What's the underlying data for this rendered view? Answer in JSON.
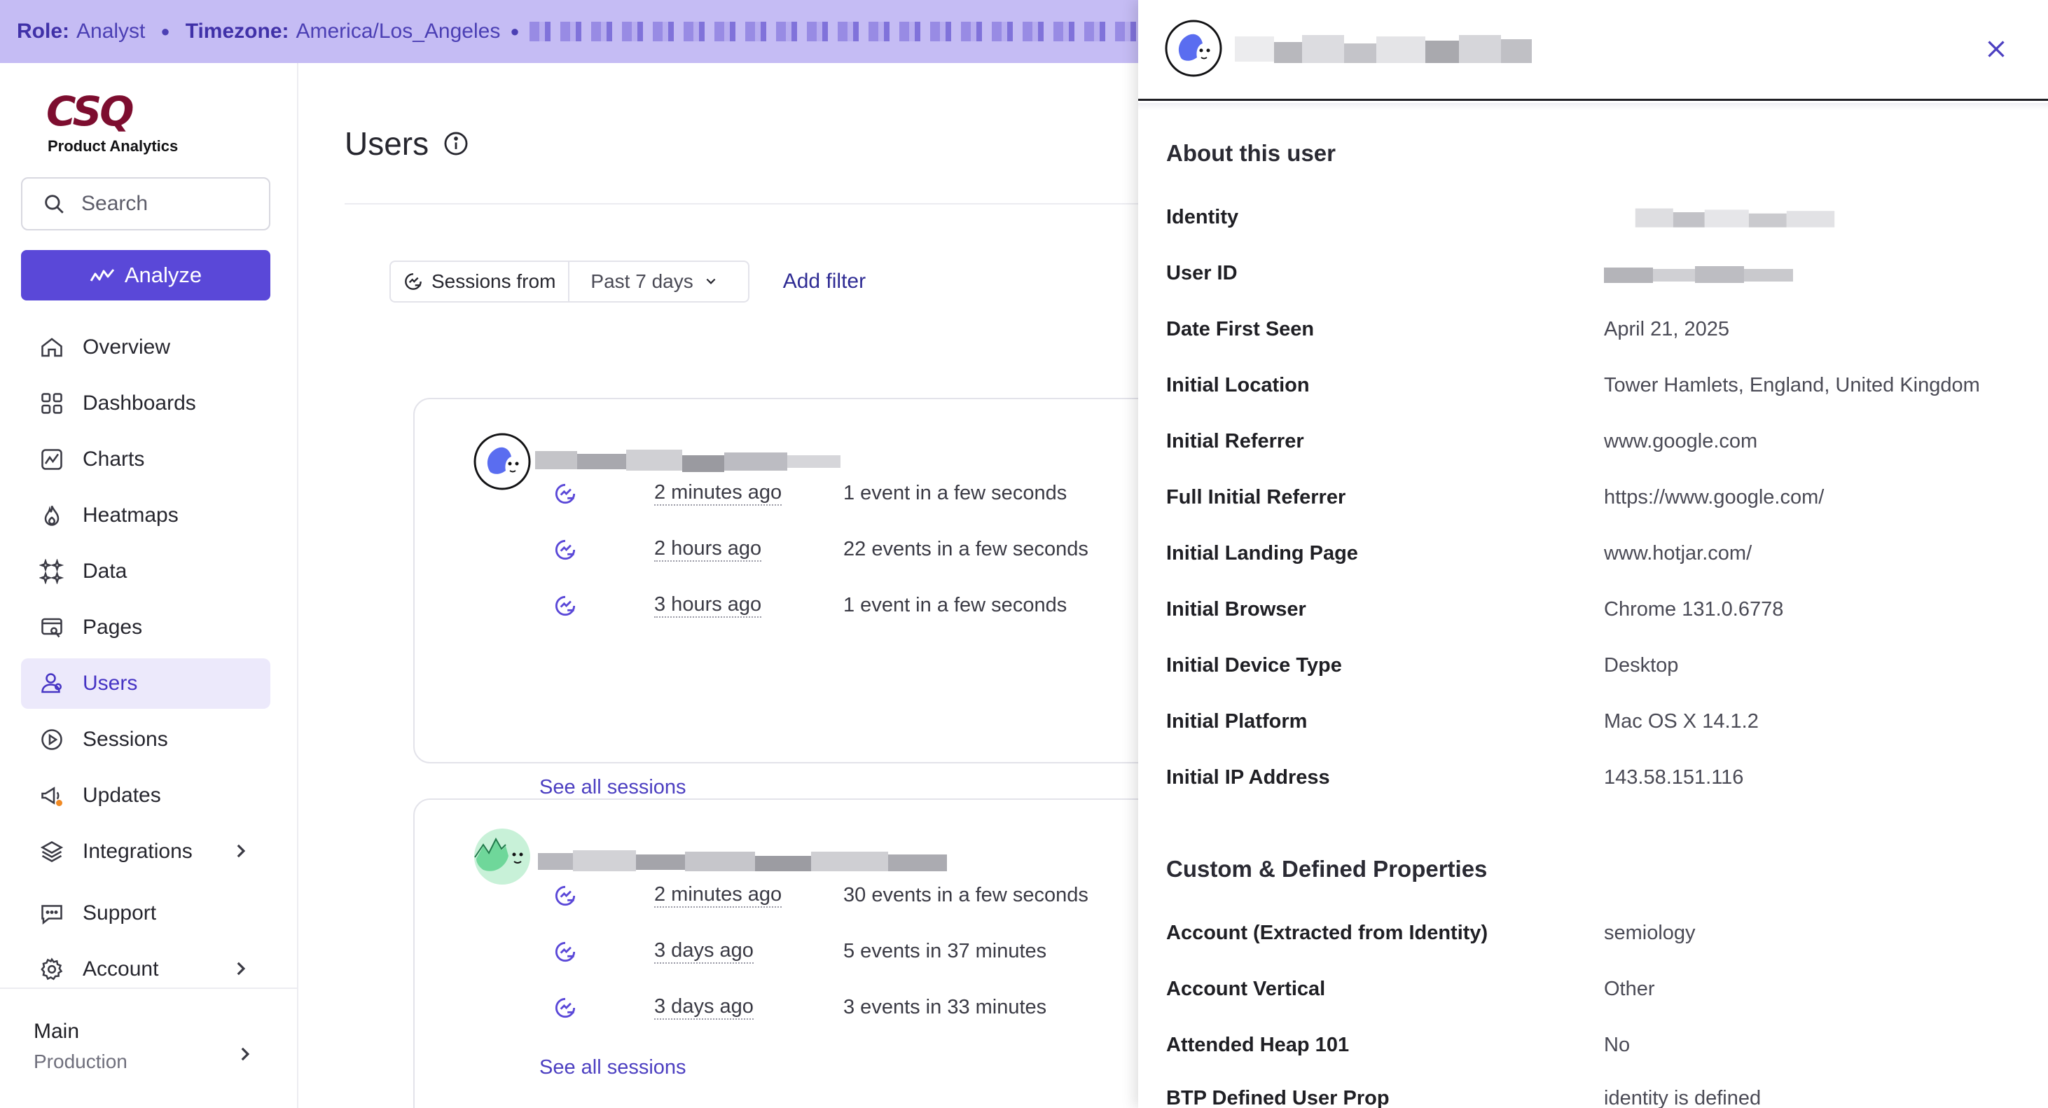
{
  "banner": {
    "role_label": "Role:",
    "role_value": "Analyst",
    "tz_label": "Timezone:",
    "tz_value": "America/Los_Angeles"
  },
  "brand": {
    "logo_text": "CSQ",
    "subtitle": "Product Analytics",
    "color": "#7d0d2f"
  },
  "search": {
    "placeholder": "Search"
  },
  "analyze": {
    "label": "Analyze",
    "color": "#5a48d8"
  },
  "nav": {
    "items": [
      {
        "label": "Overview",
        "icon": "home-icon"
      },
      {
        "label": "Dashboards",
        "icon": "dashboards-icon"
      },
      {
        "label": "Charts",
        "icon": "chart-icon"
      },
      {
        "label": "Heatmaps",
        "icon": "flame-icon"
      },
      {
        "label": "Data",
        "icon": "sparkle-icon"
      },
      {
        "label": "Pages",
        "icon": "page-icon"
      },
      {
        "label": "Users",
        "icon": "users-icon",
        "active": true
      },
      {
        "label": "Sessions",
        "icon": "play-icon"
      },
      {
        "label": "Updates",
        "icon": "megaphone-icon"
      },
      {
        "label": "Integrations",
        "icon": "layers-icon"
      },
      {
        "label": "Support",
        "icon": "chat-icon"
      },
      {
        "label": "Account",
        "icon": "gear-icon"
      }
    ]
  },
  "workspace": {
    "name": "Main",
    "environment": "Production"
  },
  "main": {
    "title": "Users",
    "filter": {
      "label": "Sessions from",
      "range": "Past 7 days"
    },
    "add_filter": "Add filter",
    "cards": [
      {
        "sessions": [
          {
            "time": "2 minutes ago",
            "events": "1 event in a few seconds"
          },
          {
            "time": "2 hours ago",
            "events": "22 events in a few seconds"
          },
          {
            "time": "3 hours ago",
            "events": "1 event in a few seconds"
          }
        ],
        "see_all": "See all sessions"
      },
      {
        "sessions": [
          {
            "time": "2 minutes ago",
            "events": "30 events in a few seconds"
          },
          {
            "time": "3 days ago",
            "events": "5 events in 37 minutes"
          },
          {
            "time": "3 days ago",
            "events": "3 events in 33 minutes"
          }
        ],
        "see_all": "See all sessions"
      }
    ]
  },
  "panel": {
    "about_title": "About this user",
    "props": [
      {
        "key": "Identity",
        "value": ""
      },
      {
        "key": "User ID",
        "value": ""
      },
      {
        "key": "Date First Seen",
        "value": "April 21, 2025"
      },
      {
        "key": "Initial Location",
        "value": "Tower Hamlets, England, United Kingdom"
      },
      {
        "key": "Initial Referrer",
        "value": "www.google.com"
      },
      {
        "key": "Full Initial Referrer",
        "value": "https://www.google.com/"
      },
      {
        "key": "Initial Landing Page",
        "value": "www.hotjar.com/"
      },
      {
        "key": "Initial Browser",
        "value": "Chrome 131.0.6778"
      },
      {
        "key": "Initial Device Type",
        "value": "Desktop"
      },
      {
        "key": "Initial Platform",
        "value": "Mac OS X 14.1.2"
      },
      {
        "key": "Initial IP Address",
        "value": "143.58.151.116"
      }
    ],
    "custom_title": "Custom & Defined Properties",
    "custom_props": [
      {
        "key": "Account (Extracted from Identity)",
        "value": "semiology"
      },
      {
        "key": "Account Vertical",
        "value": "Other"
      },
      {
        "key": "Attended Heap 101",
        "value": "No"
      },
      {
        "key": "BTP Defined User Prop",
        "value": "identity is defined"
      }
    ]
  },
  "colors": {
    "accent": "#5a48d8",
    "banner_bg": "#c5bcf4",
    "active_nav_bg": "#ece9fb",
    "link": "#4c3fc1"
  }
}
